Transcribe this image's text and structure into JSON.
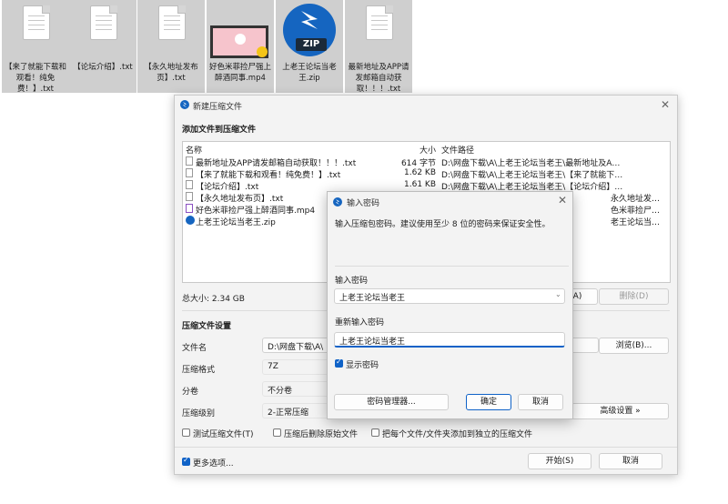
{
  "desktop": {
    "files": [
      {
        "name": "【来了就能下载和观看！纯免费！】.txt",
        "kind": "txt",
        "selected": true
      },
      {
        "name": "【论坛介绍】.txt",
        "kind": "txt",
        "selected": true
      },
      {
        "name": "【永久地址发布页】.txt",
        "kind": "txt",
        "selected": true
      },
      {
        "name": "好色米菲捡尸强上醉酒同事.mp4",
        "kind": "mp4",
        "selected": true
      },
      {
        "name": "上老王论坛当老王.zip",
        "kind": "zip",
        "selected": true
      },
      {
        "name": "最新地址及APP请发邮箱自动获取！！！.txt",
        "kind": "txt",
        "selected": true
      }
    ],
    "zip_badge": "ZIP"
  },
  "main_window": {
    "title": "新建压缩文件",
    "add_files_heading": "添加文件到压缩文件",
    "columns": {
      "name": "名称",
      "size": "大小",
      "path": "文件路径"
    },
    "rows": [
      {
        "name": "最新地址及APP请发邮箱自动获取！！！.txt",
        "size": "614 字节",
        "path": "D:\\网盘下载\\A\\上老王论坛当老王\\最新地址及A…",
        "icon": "txt"
      },
      {
        "name": "【来了就能下载和观看！纯免费！】.txt",
        "size": "1.62 KB",
        "path": "D:\\网盘下载\\A\\上老王论坛当老王\\【来了就能下…",
        "icon": "txt"
      },
      {
        "name": "【论坛介绍】.txt",
        "size": "1.61 KB",
        "path": "D:\\网盘下载\\A\\上老王论坛当老王\\【论坛介绍】…",
        "icon": "txt"
      },
      {
        "name": "【永久地址发布页】.txt",
        "size": "",
        "path": "永久地址发…",
        "icon": "txt"
      },
      {
        "name": "好色米菲捡尸强上醉酒同事.mp4",
        "size": "",
        "path": "色米菲捡尸…",
        "icon": "mp4"
      },
      {
        "name": "上老王论坛当老王.zip",
        "size": "",
        "path": "老王论坛当…",
        "icon": "zip"
      }
    ],
    "total_size": "总大小: 2.34 GB",
    "add_button": "A)",
    "delete_button": "删除(D)",
    "settings_heading": "压缩文件设置",
    "filename_label": "文件名",
    "filename_value": "D:\\网盘下载\\A\\",
    "browse_button": "浏览(B)...",
    "format_label": "压缩格式",
    "format_value": "7Z",
    "split_label": "分卷",
    "split_value": "不分卷",
    "level_label": "压缩级别",
    "level_value": "2-正常压缩",
    "advanced_button": "高级设置 »",
    "test_checkbox": "测试压缩文件(T)",
    "delete_src_checkbox": "压缩后删除原始文件",
    "each_file_checkbox": "把每个文件/文件夹添加到独立的压缩文件",
    "more_options": "更多选项...",
    "start_button": "开始(S)",
    "cancel_button": "取消"
  },
  "password_dialog": {
    "title": "输入密码",
    "description": "输入压缩包密码。建议使用至少 8 位的密码来保证安全性。",
    "enter_label": "输入密码",
    "enter_value": "上老王论坛当老王",
    "reenter_label": "重新输入密码",
    "reenter_value": "上老王论坛当老王",
    "show_password": "显示密码",
    "manager_button": "密码管理器...",
    "ok_button": "确定",
    "cancel_button": "取消"
  }
}
